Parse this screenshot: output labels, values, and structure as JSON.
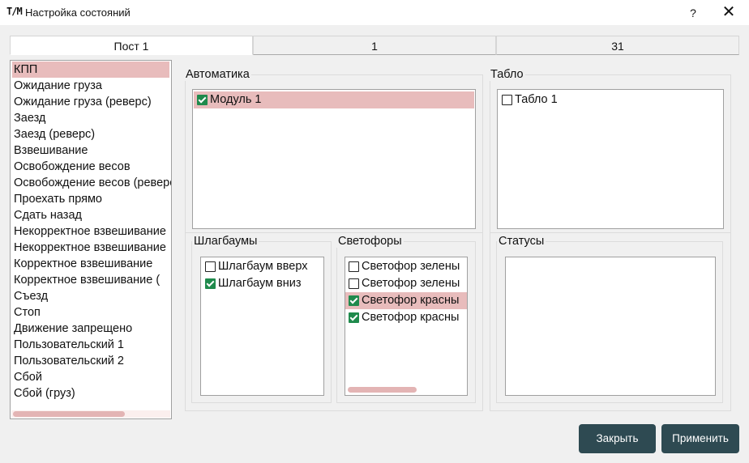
{
  "window": {
    "logo": "T/M",
    "title": "Настройка состояний",
    "help_label": "?",
    "close_label": "✕"
  },
  "tabs": [
    {
      "label": "Пост 1",
      "active": true
    },
    {
      "label": "1",
      "active": false
    },
    {
      "label": "31",
      "active": false
    }
  ],
  "states": {
    "selected_index": 0,
    "items": [
      "КПП",
      "Ожидание груза",
      "Ожидание груза (реверс)",
      "Заезд",
      "Заезд (реверс)",
      "Взвешивание",
      "Освобождение весов",
      "Освобождение весов (реверс)",
      "Проехать прямо",
      "Сдать назад",
      "Некорректное взвешивание",
      "Некорректное взвешивание",
      "Корректное взвешивание",
      "Корректное взвешивание (",
      "Съезд",
      "Стоп",
      "Движение запрещено",
      "Пользовательский 1",
      "Пользовательский 2",
      "Сбой",
      "Сбой (груз)"
    ]
  },
  "automatika": {
    "title": "Автоматика",
    "items": [
      {
        "label": "Модуль 1",
        "checked": true,
        "selected": true
      }
    ]
  },
  "tablo": {
    "title": "Табло",
    "items": [
      {
        "label": "Табло 1",
        "checked": false,
        "selected": false
      }
    ]
  },
  "shlagbaumy": {
    "title": "Шлагбаумы",
    "items": [
      {
        "label": "Шлагбаум вверх",
        "checked": false,
        "selected": false
      },
      {
        "label": "Шлагбаум вниз",
        "checked": true,
        "selected": false
      }
    ]
  },
  "svetofory": {
    "title": "Светофоры",
    "items": [
      {
        "label": "Светофор зелены",
        "checked": false,
        "selected": false
      },
      {
        "label": "Светофор зелены",
        "checked": false,
        "selected": false
      },
      {
        "label": "Светофор красны",
        "checked": true,
        "selected": true
      },
      {
        "label": "Светофор красны",
        "checked": true,
        "selected": false
      }
    ]
  },
  "statusy": {
    "title": "Статусы",
    "items": []
  },
  "buttons": {
    "close_label": "Закрыть",
    "apply_label": "Применить"
  },
  "colors": {
    "accent_button": "#2e4a52",
    "selection": "#e8bcbc",
    "checkbox_checked": "#1f8a4c"
  }
}
